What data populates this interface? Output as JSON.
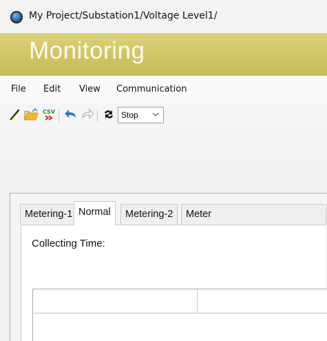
{
  "window": {
    "title": "My Project/Substation1/Voltage Level1/"
  },
  "banner": {
    "title": "Monitoring",
    "color": "#cfc464"
  },
  "menu": {
    "items": [
      "File",
      "Edit",
      "View",
      "Communication"
    ]
  },
  "toolbar": {
    "icons": [
      "pen-icon",
      "open-folder-icon",
      "export-csv-icon",
      "undo-icon",
      "redo-icon",
      "refresh-icon"
    ],
    "refresh_mode": {
      "selected": "Stop"
    }
  },
  "tabs": [
    {
      "label": "Metering-1",
      "active": false
    },
    {
      "label": "Normal",
      "active": true
    },
    {
      "label": "Metering-2",
      "active": false
    },
    {
      "label": "Meter",
      "active": false
    }
  ],
  "content": {
    "collecting_time_label": "Collecting Time:"
  }
}
